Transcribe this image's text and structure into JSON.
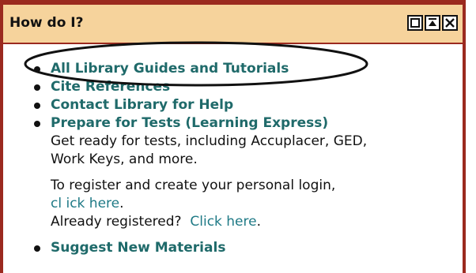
{
  "header": {
    "title": "How do I?",
    "buttons": [
      "maximize-icon",
      "collapse-icon",
      "close-icon"
    ]
  },
  "items": [
    {
      "label": "All Library Guides and Tutorials"
    },
    {
      "label": "Cite References"
    },
    {
      "label": "Contact Library for Help"
    },
    {
      "label": "Prepare for Tests (Learning Express)",
      "description_line1": "Get ready for tests, including Accuplacer, GED,",
      "description_line2": "Work Keys, and more.",
      "register_line1": "To register and create your personal login,",
      "register_link": "cl ick here",
      "register_link_suffix": ".",
      "registered_prefix": "Already registered?  ",
      "registered_link": "Click here",
      "registered_suffix": "."
    },
    {
      "label": "Suggest New Materials"
    }
  ],
  "colors": {
    "border": "#9b2a1f",
    "header_bg": "#f6d39c",
    "link": "#1f6a6a",
    "inline_link": "#1f7a86"
  }
}
